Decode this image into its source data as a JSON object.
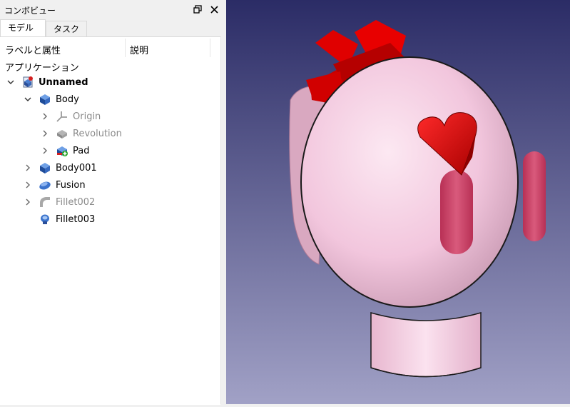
{
  "panel": {
    "title": "コンボビュー",
    "tabs": [
      {
        "label": "モデル",
        "active": true
      },
      {
        "label": "タスク",
        "active": false
      }
    ],
    "columns": {
      "label": "ラベルと属性",
      "description": "説明"
    },
    "section": "アプリケーション"
  },
  "tree": [
    {
      "label": "Unnamed",
      "level": 0,
      "expander": "expanded",
      "icon": "document-icon",
      "bold": true,
      "grayed": false
    },
    {
      "label": "Body",
      "level": 1,
      "expander": "expanded",
      "icon": "body-icon",
      "bold": false,
      "grayed": false
    },
    {
      "label": "Origin",
      "level": 2,
      "expander": "collapsed",
      "icon": "origin-icon",
      "bold": false,
      "grayed": true
    },
    {
      "label": "Revolution",
      "level": 2,
      "expander": "collapsed",
      "icon": "revolution-icon",
      "bold": false,
      "grayed": true
    },
    {
      "label": "Pad",
      "level": 2,
      "expander": "collapsed",
      "icon": "pad-icon",
      "bold": false,
      "grayed": false
    },
    {
      "label": "Body001",
      "level": 1,
      "expander": "collapsed",
      "icon": "body-icon",
      "bold": false,
      "grayed": false
    },
    {
      "label": "Fusion",
      "level": 1,
      "expander": "collapsed",
      "icon": "fusion-icon",
      "bold": false,
      "grayed": false
    },
    {
      "label": "Fillet002",
      "level": 1,
      "expander": "collapsed",
      "icon": "fillet-icon",
      "bold": false,
      "grayed": true
    },
    {
      "label": "Fillet003",
      "level": 1,
      "expander": "none",
      "icon": "fillet-solid-icon",
      "bold": false,
      "grayed": false
    }
  ],
  "colors": {
    "viewport_top": "#2b2c66",
    "viewport_bottom": "#a1a1c6",
    "model_pink": "#f7d3e6",
    "feature_red": "#d40000",
    "oval_red": "#cc4060"
  }
}
